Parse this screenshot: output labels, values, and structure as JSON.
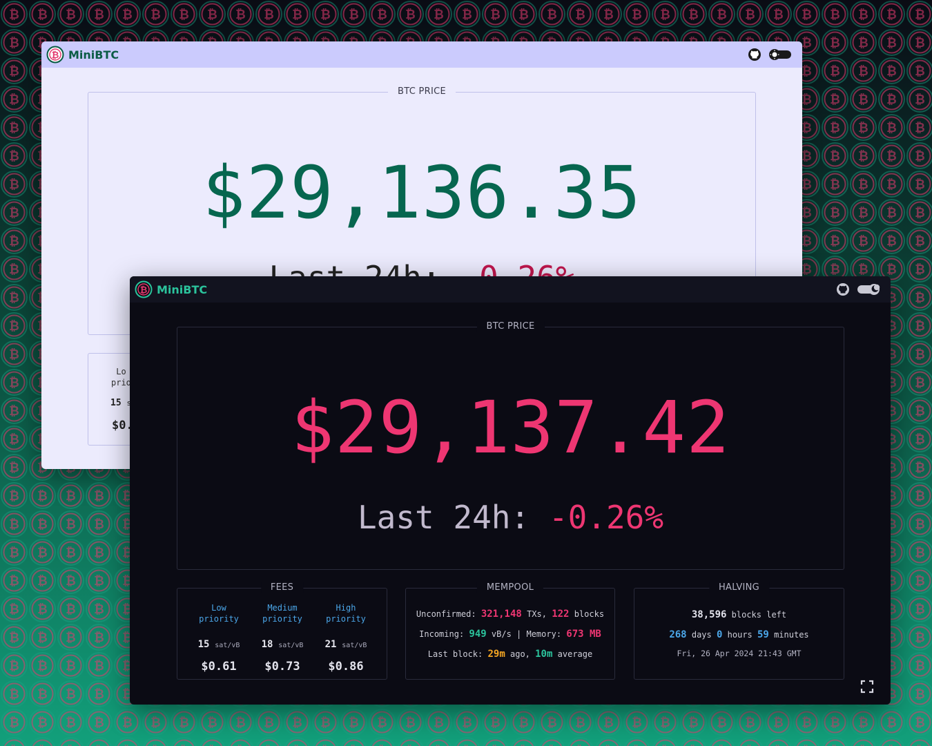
{
  "colors": {
    "background_top": "#0b0b14",
    "background_bottom": "#11a07a",
    "light_price": "#06664f",
    "dark_price": "#ee3672",
    "accent_green": "#2bc39c",
    "accent_blue": "#4ba6e8",
    "accent_orange": "#f5a623"
  },
  "light_window": {
    "app_name": "MiniBTC",
    "icons": [
      "bitcoin-logo-icon",
      "github-icon",
      "theme-toggle-icon"
    ],
    "price_panel": {
      "legend": "BTC PRICE",
      "price": "$29,136.35",
      "change_label": "Last 24h: ",
      "change_value": "-0.26%"
    },
    "fees_partial": {
      "label_line1": "Lo",
      "label_line2": "prio",
      "sat_value": "15",
      "sat_unit": "s",
      "usd": "$0."
    }
  },
  "dark_window": {
    "app_name": "MiniBTC",
    "icons": [
      "bitcoin-logo-icon",
      "github-icon",
      "theme-toggle-icon",
      "fullscreen-icon"
    ],
    "price_panel": {
      "legend": "BTC PRICE",
      "price": "$29,137.42",
      "change_label": "Last 24h: ",
      "change_value": "-0.26%"
    },
    "fees": {
      "legend": "FEES",
      "items": [
        {
          "label_line1": "Low",
          "label_line2": "priority",
          "sat": "15",
          "unit": "sat/vB",
          "usd": "$0.61"
        },
        {
          "label_line1": "Medium",
          "label_line2": "priority",
          "sat": "18",
          "unit": "sat/vB",
          "usd": "$0.73"
        },
        {
          "label_line1": "High",
          "label_line2": "priority",
          "sat": "21",
          "unit": "sat/vB",
          "usd": "$0.86"
        }
      ]
    },
    "mempool": {
      "legend": "MEMPOOL",
      "unconfirmed_label": "Unconfirmed: ",
      "unconfirmed_txs": "321,148",
      "txs_label": " TXs, ",
      "blocks": "122",
      "blocks_label": " blocks",
      "incoming_label": "Incoming: ",
      "incoming": "949",
      "incoming_unit": " vB/s | Memory: ",
      "memory": "673 MB",
      "last_block_label": "Last block: ",
      "last_block": "29m",
      "ago_label": " ago, ",
      "average": "10m",
      "average_label": " average"
    },
    "halving": {
      "legend": "HALVING",
      "blocks_left": "38,596",
      "blocks_left_label": " blocks left",
      "days": "268",
      "days_label": " days ",
      "hours": "0",
      "hours_label": " hours ",
      "minutes": "59",
      "minutes_label": " minutes",
      "date": "Fri, 26 Apr 2024 21:43 GMT"
    }
  }
}
